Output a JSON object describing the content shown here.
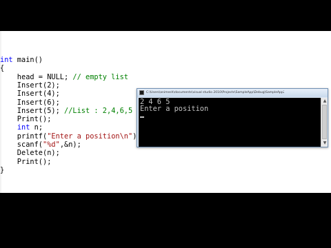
{
  "editor": {
    "lines": [
      {
        "parts": [
          {
            "t": "kw",
            "v": "int"
          },
          {
            "t": "tx",
            "v": " main()"
          }
        ]
      },
      {
        "parts": [
          {
            "t": "tx",
            "v": "{"
          }
        ]
      },
      {
        "parts": [
          {
            "t": "tx",
            "v": "    head = NULL; "
          },
          {
            "t": "cm",
            "v": "// empty list"
          }
        ]
      },
      {
        "parts": [
          {
            "t": "tx",
            "v": "    Insert(2);"
          }
        ]
      },
      {
        "parts": [
          {
            "t": "tx",
            "v": "    Insert(4);"
          }
        ]
      },
      {
        "parts": [
          {
            "t": "tx",
            "v": "    Insert(6);"
          }
        ]
      },
      {
        "parts": [
          {
            "t": "tx",
            "v": "    Insert(5); "
          },
          {
            "t": "cm",
            "v": "//List : 2,4,6,5"
          }
        ]
      },
      {
        "parts": [
          {
            "t": "tx",
            "v": "    Print();"
          }
        ]
      },
      {
        "parts": [
          {
            "t": "tx",
            "v": "    "
          },
          {
            "t": "kw",
            "v": "int"
          },
          {
            "t": "tx",
            "v": " n;"
          }
        ]
      },
      {
        "parts": [
          {
            "t": "tx",
            "v": "    printf("
          },
          {
            "t": "st",
            "v": "\"Enter a position\\n\""
          },
          {
            "t": "tx",
            "v": ");"
          }
        ]
      },
      {
        "parts": [
          {
            "t": "tx",
            "v": "    scanf("
          },
          {
            "t": "st",
            "v": "\"%d\""
          },
          {
            "t": "tx",
            "v": ",&n);"
          }
        ]
      },
      {
        "parts": [
          {
            "t": "tx",
            "v": "    Delete(n);"
          }
        ]
      },
      {
        "parts": [
          {
            "t": "tx",
            "v": "    Print();"
          }
        ]
      },
      {
        "parts": [
          {
            "t": "tx",
            "v": "}"
          }
        ]
      }
    ]
  },
  "console": {
    "title": "C:\\Users\\animesh\\documents\\visual studio 2010\\Projects\\SampleApp\\Debug\\SampleApp2.exe",
    "lines": [
      "2 4 6 5",
      "Enter a position"
    ],
    "colors": {
      "background": "#000000",
      "text": "#c0c0c0"
    }
  },
  "colors": {
    "keyword": "#0000ff",
    "comment": "#008000",
    "string": "#a31515",
    "text": "#000000"
  }
}
